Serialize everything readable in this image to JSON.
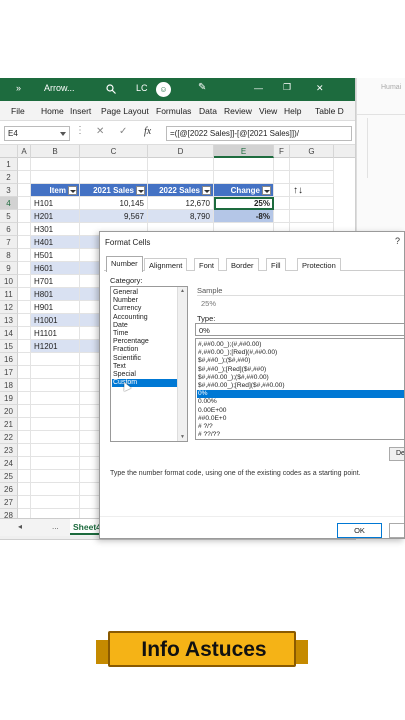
{
  "background_window": {
    "hint": "Humai"
  },
  "titlebar": {
    "chevron": "»",
    "filename": "Arrow...",
    "user_initials": "LC",
    "profile_icon": "smiley-icon",
    "minimize": "—",
    "restore": "❐",
    "close": "✕",
    "color": "#1d6b3e"
  },
  "menu": [
    "File",
    "Home",
    "Insert",
    "Page Layout",
    "Formulas",
    "Data",
    "Review",
    "View",
    "Help",
    "Table D"
  ],
  "formula_bar": {
    "name_box": "E4",
    "cancel": "✕",
    "enter": "✓",
    "fx": "fx",
    "formula": "=([@[2022 Sales]]-[@[2021 Sales]])/"
  },
  "columns": [
    "A",
    "B",
    "C",
    "D",
    "E",
    "F",
    "G"
  ],
  "rows": [
    "1",
    "2",
    "3",
    "4",
    "5",
    "6",
    "7",
    "8",
    "9",
    "10",
    "11",
    "12",
    "13",
    "14",
    "15",
    "16",
    "17",
    "18",
    "19",
    "20",
    "21",
    "22",
    "23",
    "24",
    "25",
    "26",
    "27",
    "28"
  ],
  "table": {
    "headers": [
      "Item",
      "2021 Sales",
      "2022 Sales",
      "Change"
    ],
    "rows": [
      [
        "H101",
        "10,145",
        "12,670",
        "25%"
      ],
      [
        "H201",
        "9,567",
        "8,790",
        "-8%"
      ],
      [
        "H301",
        "",
        "",
        ""
      ],
      [
        "H401",
        "",
        "",
        ""
      ],
      [
        "H501",
        "",
        "",
        ""
      ],
      [
        "H601",
        "",
        "",
        ""
      ],
      [
        "H701",
        "",
        "",
        ""
      ],
      [
        "H801",
        "",
        "",
        ""
      ],
      [
        "H901",
        "",
        "",
        ""
      ],
      [
        "H1001",
        "",
        "",
        ""
      ],
      [
        "H1101",
        "",
        "",
        ""
      ],
      [
        "H1201",
        "",
        "",
        ""
      ]
    ],
    "arrows": "↑↓",
    "header_color": "#4472c4",
    "band_color": "#d9e1f2"
  },
  "sheet_tabs": {
    "prev": "◂",
    "ellipsis": "...",
    "active": "Sheet4"
  },
  "dialog": {
    "title": "Format Cells",
    "help": "?",
    "tabs": [
      "Number",
      "Alignment",
      "Font",
      "Border",
      "Fill",
      "Protection"
    ],
    "category_label": "Category:",
    "categories": [
      "General",
      "Number",
      "Currency",
      "Accounting",
      "Date",
      "Time",
      "Percentage",
      "Fraction",
      "Scientific",
      "Text",
      "Special",
      "Custom"
    ],
    "selected_category": "Custom",
    "sample_label": "Sample",
    "sample_value": "25%",
    "type_label": "Type:",
    "type_value": "0%",
    "codes": [
      "#,##0.00_);(#,##0.00)",
      "#,##0.00_);[Red](#,##0.00)",
      "$#,##0_);($#,##0)",
      "$#,##0_);[Red]($#,##0)",
      "$#,##0.00_);($#,##0.00)",
      "$#,##0.00_);[Red]($#,##0.00)",
      "0%",
      "0.00%",
      "0.00E+00",
      "##0.0E+0",
      "# ?/?",
      "# ??/??"
    ],
    "selected_code": "0%",
    "delete_label": "De",
    "description": "Type the number format code, using one of the existing codes as a starting point.",
    "ok_label": "OK",
    "select_color": "#0078d4"
  },
  "banner": {
    "text": "Info Astuces",
    "color": "#f5b316"
  }
}
